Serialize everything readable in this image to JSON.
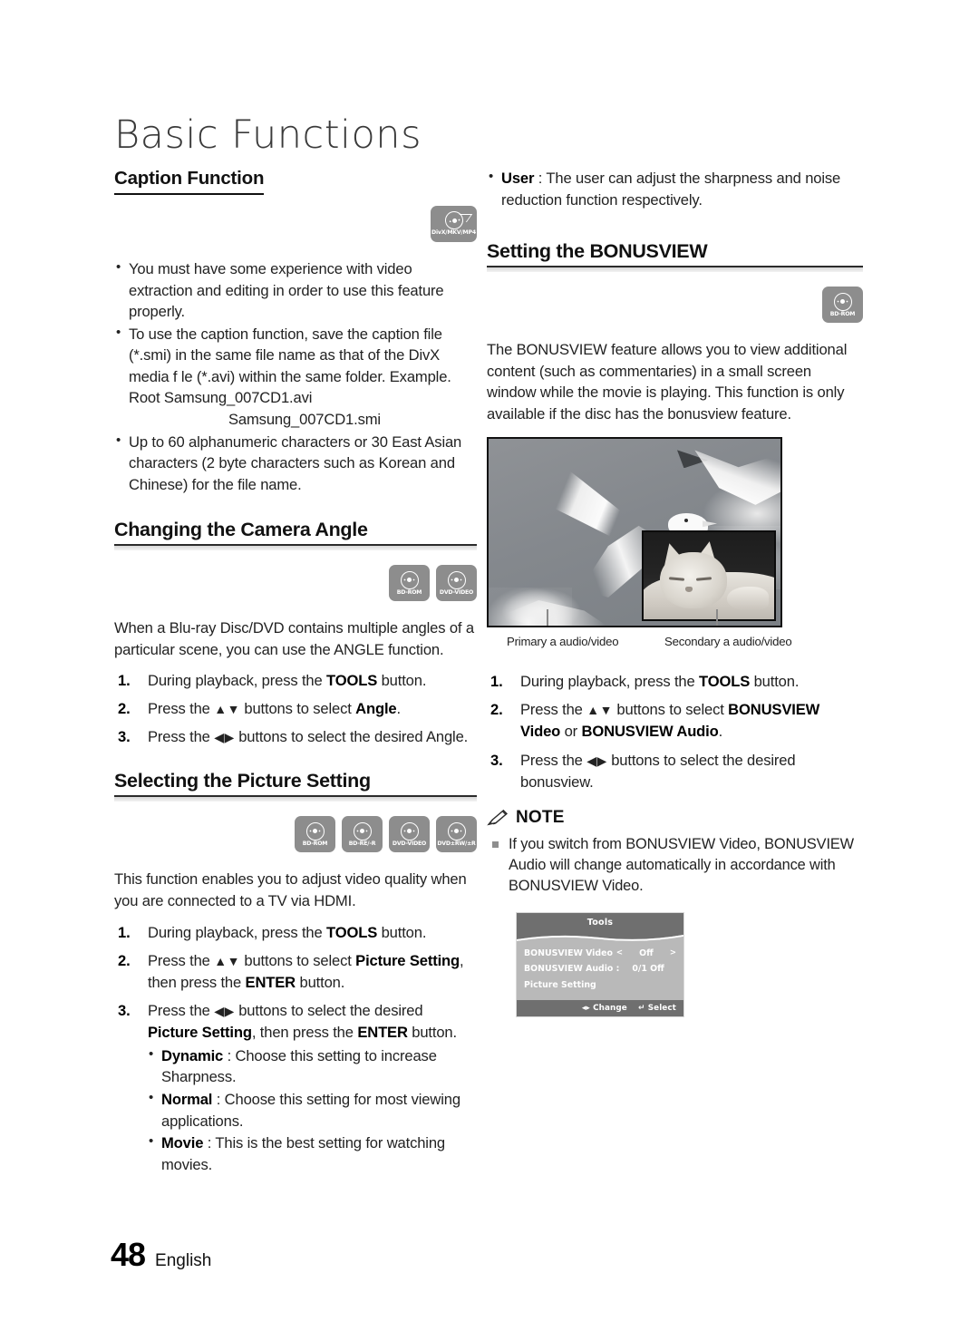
{
  "chapter": {
    "title": "Basic Functions"
  },
  "left_column": {
    "caption_function": {
      "heading": "Caption Function",
      "badges": [
        {
          "label": "DivX/MKV/MP4",
          "icon": "disc-divx-icon"
        }
      ],
      "bullets": [
        "You must have some experience with video extraction and editing in order to use this feature properly.",
        "To use the caption function, save the caption file (*.smi) in the same file name as that of the DivX media f le (*.avi) within the same folder.",
        "Up to 60 alphanumeric characters or 30 East Asian characters (2 byte characters such as Korean and Chinese) for the file name."
      ],
      "example_line1": "Example. Root Samsung_007CD1.avi",
      "example_line2": "Samsung_007CD1.smi"
    },
    "camera_angle": {
      "heading": "Changing the Camera Angle",
      "badges": [
        {
          "label": "BD-ROM",
          "icon": "disc-bd-rom-icon"
        },
        {
          "label": "DVD-VIDEO",
          "icon": "disc-dvd-video-icon"
        }
      ],
      "intro": "When a Blu-ray Disc/DVD contains multiple angles of a particular scene, you can use the ANGLE function.",
      "steps": [
        {
          "num": "1.",
          "pre": "During playback, press the ",
          "bold": "TOOLS",
          "post": " button."
        },
        {
          "num": "2.",
          "pre": "Press the ",
          "arrows": "▲▼",
          "mid": " buttons to select ",
          "bold": "Angle",
          "post": "."
        },
        {
          "num": "3.",
          "pre": "Press the ",
          "arrows": "◀▶",
          "mid": " buttons to select the desired Angle.",
          "bold": "",
          "post": ""
        }
      ]
    },
    "picture_setting": {
      "heading": "Selecting the Picture Setting",
      "badges": [
        {
          "label": "BD-ROM",
          "icon": "disc-bd-rom-icon"
        },
        {
          "label": "BD-RE/-R",
          "icon": "disc-bd-re-r-icon"
        },
        {
          "label": "DVD-VIDEO",
          "icon": "disc-dvd-video-icon"
        },
        {
          "label": "DVD±RW/±R",
          "icon": "disc-dvd-rw-r-icon"
        }
      ],
      "intro": "This function enables you to adjust video quality when you are connected to a TV via HDMI.",
      "step1_pre": "During playback, press the ",
      "step1_bold": "TOOLS",
      "step1_post": " button.",
      "step2_pre": "Press the ",
      "step2_arrows": "▲▼",
      "step2_mid": " buttons to select ",
      "step2_bold1": "Picture Setting",
      "step2_mid2": ", then press the ",
      "step2_bold2": "ENTER",
      "step2_post": " button.",
      "step3_pre": "Press the ",
      "step3_arrows": "◀▶",
      "step3_mid": " buttons to select the desired ",
      "step3_bold1": "Picture Setting",
      "step3_mid2": ", then press the ",
      "step3_bold2": "ENTER",
      "step3_post": " button.",
      "options": [
        {
          "name": "Dynamic",
          "sep": " : ",
          "desc": "Choose this setting to increase Sharpness."
        },
        {
          "name": "Normal",
          "sep": " : ",
          "desc": "Choose this setting for most viewing applications."
        },
        {
          "name": "Movie",
          "sep": " : ",
          "desc": "This is the best setting for watching movies."
        }
      ]
    }
  },
  "right_column": {
    "user_option": {
      "name": "User",
      "sep": " : ",
      "desc": "The user can adjust the sharpness and noise reduction function respectively."
    },
    "bonusview": {
      "heading": "Setting the BONUSVIEW",
      "badges": [
        {
          "label": "BD-ROM",
          "icon": "disc-bd-rom-icon"
        }
      ],
      "intro": "The BONUSVIEW feature allows you to view additional content (such as commentaries) in a small screen window while the movie is playing. This function is only available if the disc has the bonusview feature.",
      "figure": {
        "primary_caption": "Primary a audio/video",
        "secondary_caption": "Secondary a audio/video",
        "primary_subject": "seagulls-flying-photo",
        "secondary_subject": "sleeping-cat-photo"
      },
      "steps": [
        {
          "num": "1.",
          "pre": "During playback, press the ",
          "bold": "TOOLS",
          "post": " button."
        },
        {
          "num": "2.",
          "pre": "Press the ",
          "arrows": "▲▼",
          "mid": " buttons to select ",
          "bold1": "BONUSVIEW Video",
          "mid2": " or ",
          "bold2": "BONUSVIEW Audio",
          "post": "."
        },
        {
          "num": "3.",
          "pre": "Press the ",
          "arrows": "◀▶",
          "mid": " buttons to select the desired bonusview.",
          "post": ""
        }
      ],
      "note": {
        "title": "NOTE",
        "items": [
          "If you switch from BONUSVIEW Video, BONUSVIEW Audio will change automatically in accordance with BONUSVIEW Video."
        ]
      },
      "osd": {
        "title": "Tools",
        "rows": [
          {
            "label": "BONUSVIEW Video",
            "caret_left": "<",
            "value": "Off",
            "caret_right": ">"
          },
          {
            "label": "BONUSVIEW Audio :",
            "caret_left": "",
            "value": "0/1 Off",
            "caret_right": ""
          },
          {
            "label": "Picture Setting",
            "caret_left": "",
            "value": "",
            "caret_right": ""
          }
        ],
        "footer_change_arrows": "◂▸",
        "footer_change": "Change",
        "footer_select_icon": "↵",
        "footer_select": "Select"
      }
    }
  },
  "footer": {
    "page_number": "48",
    "language": "English"
  },
  "colors": {
    "badge_gray": "#8d8d8d",
    "osd_header": "#6f6f6f",
    "osd_body": "#b9b9b9",
    "rule_dark": "#2b2b2b"
  }
}
